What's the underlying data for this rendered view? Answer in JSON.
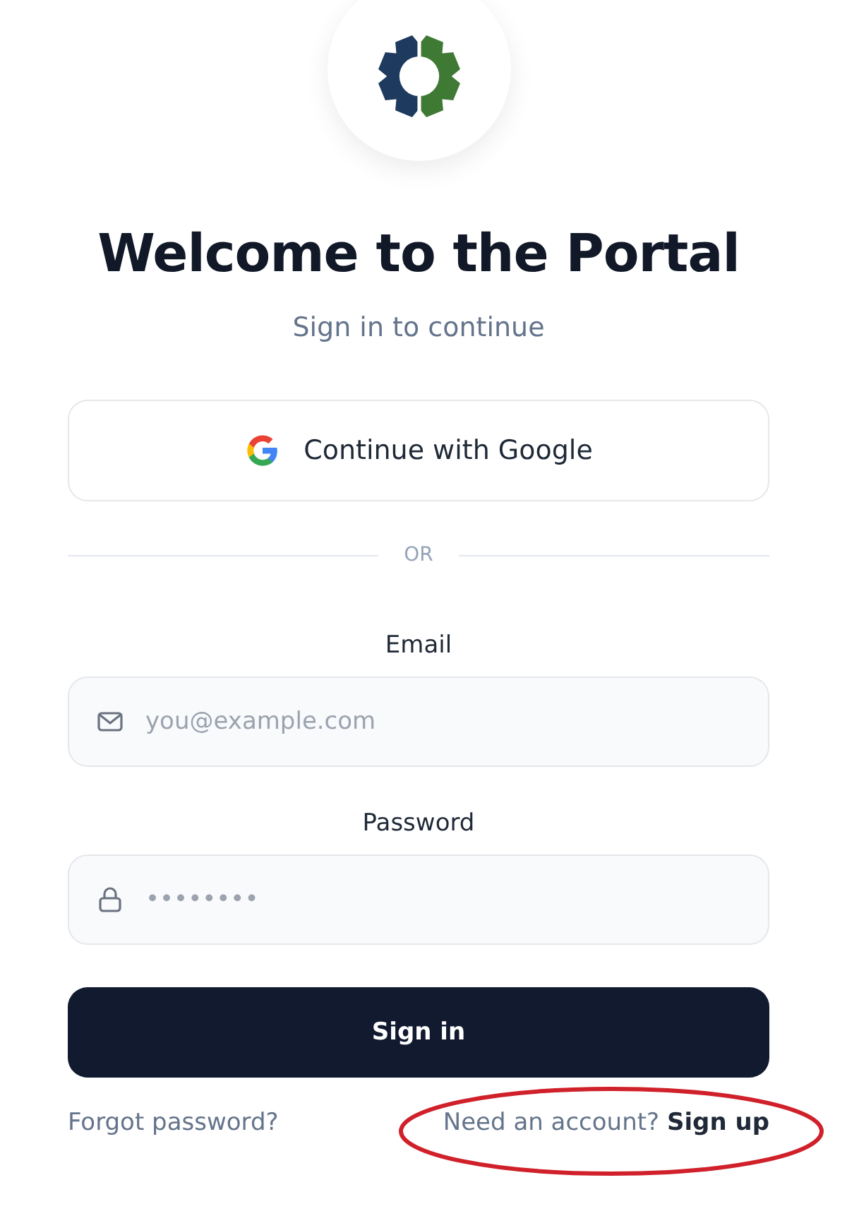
{
  "title": "Welcome to the Portal",
  "subtitle": "Sign in to continue",
  "google_button": {
    "label": "Continue with Google"
  },
  "divider": "OR",
  "fields": [
    {
      "label": "Email",
      "kind": "email",
      "placeholder": "you@example.com"
    },
    {
      "label": "Password",
      "kind": "password",
      "placeholder": "••••••••"
    }
  ],
  "submit": "Sign in",
  "forgot_link": "Forgot password?",
  "signup": {
    "prompt": "Need an account?",
    "link": "Sign up"
  }
}
